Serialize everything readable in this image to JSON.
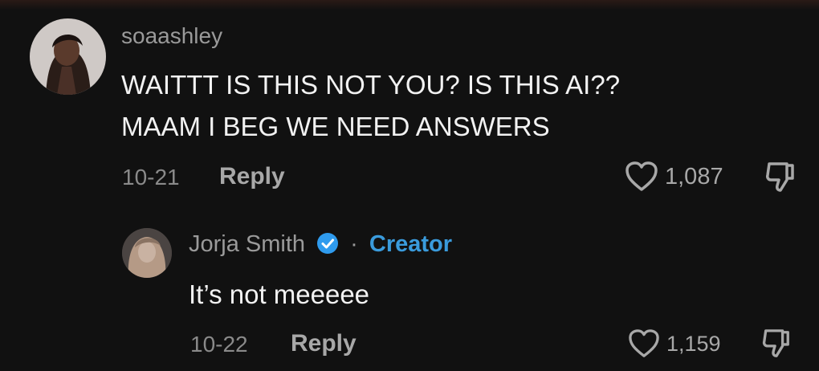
{
  "comments": [
    {
      "username": "soaashley",
      "lines": [
        "WAITTT IS THIS NOT YOU? IS THIS AI??",
        "MAAM I BEG WE NEED ANSWERS"
      ],
      "date": "10-21",
      "reply_label": "Reply",
      "likes": "1,087"
    }
  ],
  "reply": {
    "username": "Jorja Smith",
    "separator": "·",
    "badge": "Creator",
    "text": "It’s not meeeee",
    "date": "10-22",
    "reply_label": "Reply",
    "likes": "1,159"
  },
  "colors": {
    "background": "#111111",
    "creator_accent": "#3a9bdc",
    "verified_badge": "#2f9bee"
  },
  "icons": [
    "heart-icon",
    "dislike-icon",
    "verified-badge-icon"
  ]
}
